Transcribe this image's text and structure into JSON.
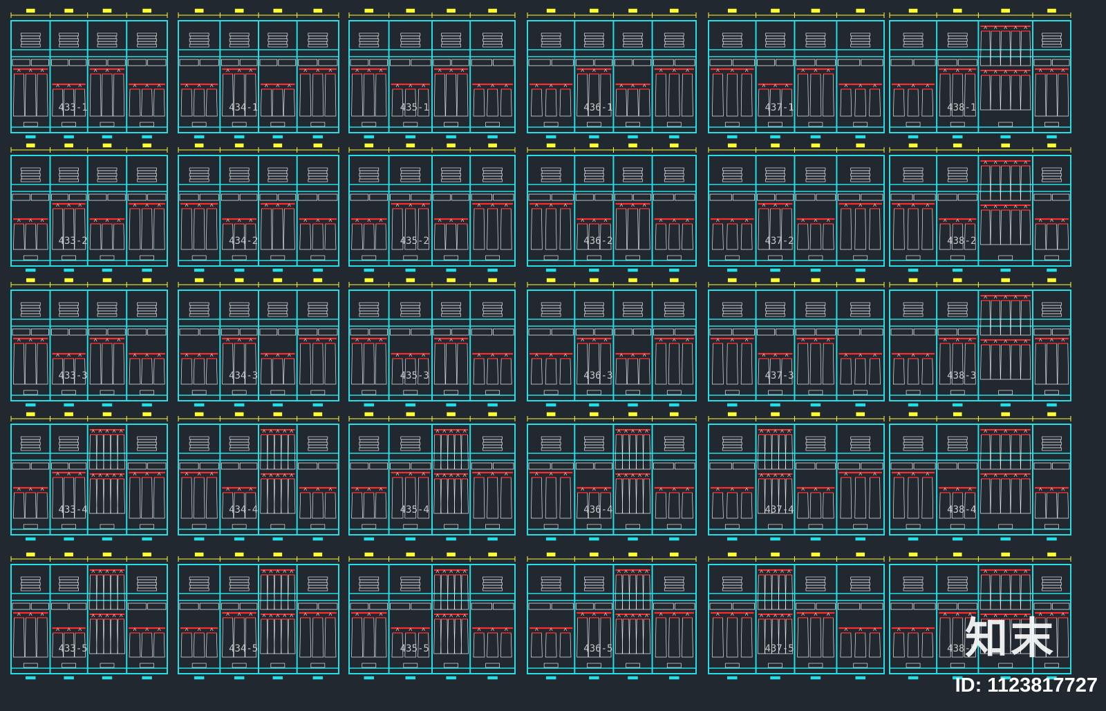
{
  "colors": {
    "background": "#212830",
    "frame": "#22e0e6",
    "dimension": "#ffff33",
    "rod": "#ff2a2a",
    "garment": "#e6e6e6"
  },
  "drawing": {
    "rows": 5,
    "columns": 6,
    "panel_labels": [
      [
        "433-1",
        "434-1",
        "435-1",
        "436-1",
        "437-1",
        "438-1"
      ],
      [
        "433-2",
        "434-2",
        "435-2",
        "436-2",
        "437-2",
        "438-2"
      ],
      [
        "433-3",
        "434-3",
        "435-3",
        "436-3",
        "437-3",
        "438-3"
      ],
      [
        "433-4",
        "434-4",
        "435-4",
        "436-4",
        "437-4",
        "438-4"
      ],
      [
        "433-5",
        "434-5",
        "435-5",
        "436-5",
        "437-5",
        "438-5"
      ]
    ]
  },
  "watermark": {
    "logo_text": "知末",
    "id_text": "ID: 1123817727"
  }
}
